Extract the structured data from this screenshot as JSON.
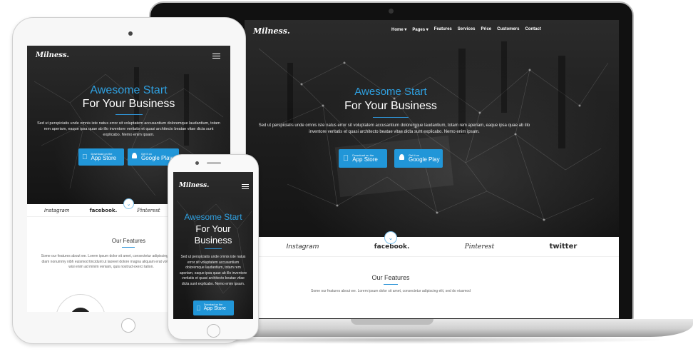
{
  "brand": {
    "logo_text": "Milness."
  },
  "nav": {
    "items": [
      {
        "label": "Home",
        "has_dropdown": true
      },
      {
        "label": "Pages",
        "has_dropdown": true
      },
      {
        "label": "Features",
        "has_dropdown": false
      },
      {
        "label": "Services",
        "has_dropdown": false
      },
      {
        "label": "Price",
        "has_dropdown": false
      },
      {
        "label": "Customers",
        "has_dropdown": false
      },
      {
        "label": "Contact",
        "has_dropdown": false
      }
    ]
  },
  "hero": {
    "title_accent": "Awesome Start",
    "title_main": "For Your Business",
    "title_main_line1": "For Your",
    "title_main_line2": "Business",
    "description": "Sed ut perspiciatis unde omnis iste natus error sit voluptatem accusantium doloremque laudantium, totam rem aperiam, eaque ipsa quae ab illo inventore veritatis et quasi architecto beatae vitae dicta sunt explicabo. Nemo enim ipsam.",
    "app_store": {
      "small": "Download on the",
      "big": "App Store"
    },
    "google_play": {
      "small": "Get it on",
      "big": "Google Play"
    }
  },
  "brands": [
    "Instagram",
    "facebook.",
    "Pinterest",
    "twitter"
  ],
  "features": {
    "title": "Our Features",
    "text_desktop": "Some our features about we. Lorem ipsum dolor sit amet, consectetur adipiscing elit, sed do eiusmod",
    "text_tablet": "Some our features about we. Lorem ipsum dolor sit amet, consectetur adipiscing elit, sed diam nonummy nibh euismod tincidunt ut laoreet dolore magna aliquam erat volutpat. Ut wisi enim ad minim veniam, quis nostrud exerci tation."
  },
  "colors": {
    "accent": "#2fa0e0",
    "button": "#2196d8",
    "dark": "#1d1d1d"
  },
  "icons": [
    "apple-icon",
    "android-icon",
    "hamburger-menu-icon",
    "chevron-down-icon"
  ]
}
